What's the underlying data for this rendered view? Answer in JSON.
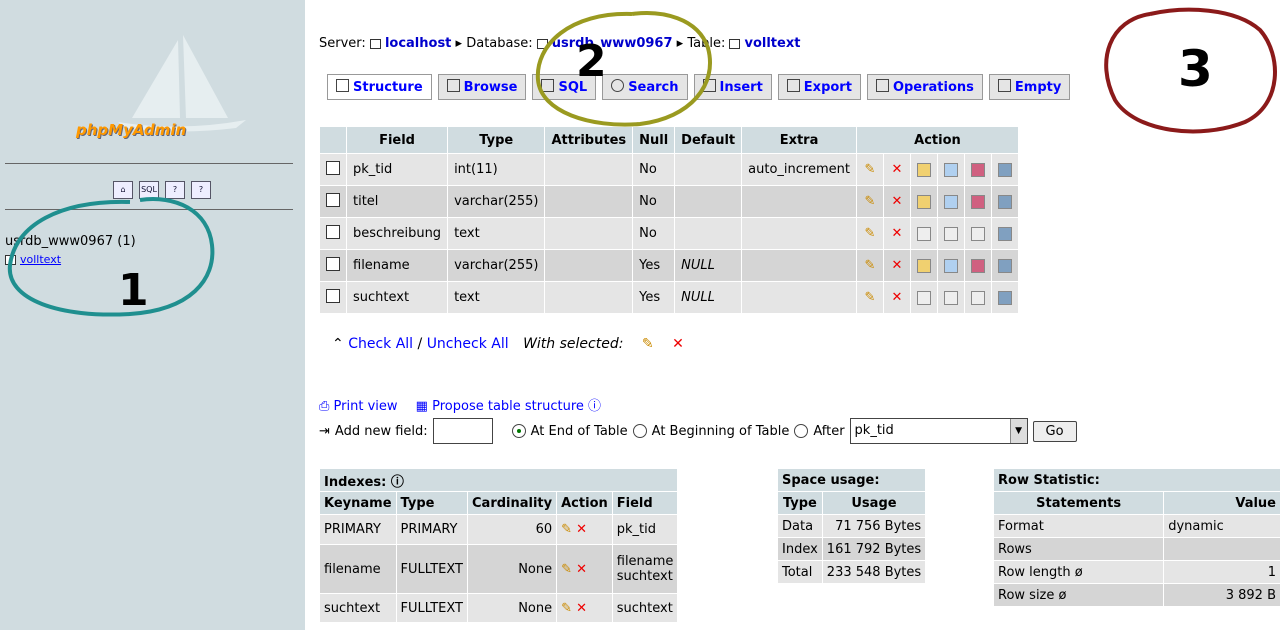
{
  "sidebar": {
    "logo_text": "phpMyAdmin",
    "nav_icons": [
      "home-icon",
      "sql-icon",
      "query-icon",
      "docs-icon"
    ],
    "db_label": "usrdb_www0967 (1)",
    "table_link": "volltext"
  },
  "breadcrumb": {
    "server_label": "Server:",
    "server": "localhost",
    "database_label": "Database:",
    "database": "usrdb_www0967",
    "table_label": "Table:",
    "table": "volltext"
  },
  "tabs": [
    "Structure",
    "Browse",
    "SQL",
    "Search",
    "Insert",
    "Export",
    "Operations",
    "Empty"
  ],
  "field_table": {
    "headers": [
      "Field",
      "Type",
      "Attributes",
      "Null",
      "Default",
      "Extra",
      "Action"
    ],
    "rows": [
      {
        "field": "pk_tid",
        "type": "int(11)",
        "attributes": "",
        "null": "No",
        "default": "",
        "extra": "auto_increment"
      },
      {
        "field": "titel",
        "type": "varchar(255)",
        "attributes": "",
        "null": "No",
        "default": "",
        "extra": ""
      },
      {
        "field": "beschreibung",
        "type": "text",
        "attributes": "",
        "null": "No",
        "default": "",
        "extra": ""
      },
      {
        "field": "filename",
        "type": "varchar(255)",
        "attributes": "",
        "null": "Yes",
        "default": "NULL",
        "extra": ""
      },
      {
        "field": "suchtext",
        "type": "text",
        "attributes": "",
        "null": "Yes",
        "default": "NULL",
        "extra": ""
      }
    ]
  },
  "bulk": {
    "check_all": "Check All",
    "separator": "/",
    "uncheck_all": "Uncheck All",
    "with_selected": "With selected:"
  },
  "links": {
    "print_view": "Print view",
    "propose": "Propose table structure"
  },
  "add_field": {
    "label": "Add new field:",
    "opt_end": "At End of Table",
    "opt_begin": "At Beginning of Table",
    "opt_after": "After",
    "after_value": "pk_tid",
    "go": "Go"
  },
  "indexes": {
    "title": "Indexes:",
    "headers": [
      "Keyname",
      "Type",
      "Cardinality",
      "Action",
      "Field"
    ],
    "rows": [
      {
        "keyname": "PRIMARY",
        "type": "PRIMARY",
        "cardinality": "60",
        "field": "pk_tid"
      },
      {
        "keyname": "filename",
        "type": "FULLTEXT",
        "cardinality": "None",
        "field": "filename",
        "field2": "suchtext"
      },
      {
        "keyname": "suchtext",
        "type": "FULLTEXT",
        "cardinality": "None",
        "field": "suchtext"
      }
    ]
  },
  "space": {
    "title": "Space usage:",
    "headers": [
      "Type",
      "Usage"
    ],
    "rows": [
      {
        "type": "Data",
        "usage": "71 756 Bytes"
      },
      {
        "type": "Index",
        "usage": "161 792 Bytes"
      },
      {
        "type": "Total",
        "usage": "233 548 Bytes"
      }
    ]
  },
  "rowstats": {
    "title": "Row Statistic:",
    "headers": [
      "Statements",
      "Value"
    ],
    "rows": [
      {
        "statement": "Format",
        "value": "dynamic"
      },
      {
        "statement": "Rows",
        "value": ""
      },
      {
        "statement": "Row length ø",
        "value": "1"
      },
      {
        "statement": "Row size ø",
        "value": "3 892 B"
      }
    ]
  },
  "annotations": {
    "one": "1",
    "two": "2",
    "three": "3"
  },
  "colors": {
    "sidebar": "#d0dce0",
    "link": "#0000ff",
    "annot_teal": "#1f8f8f",
    "annot_olive": "#9a9a20",
    "annot_maroon": "#8b1a1a"
  }
}
